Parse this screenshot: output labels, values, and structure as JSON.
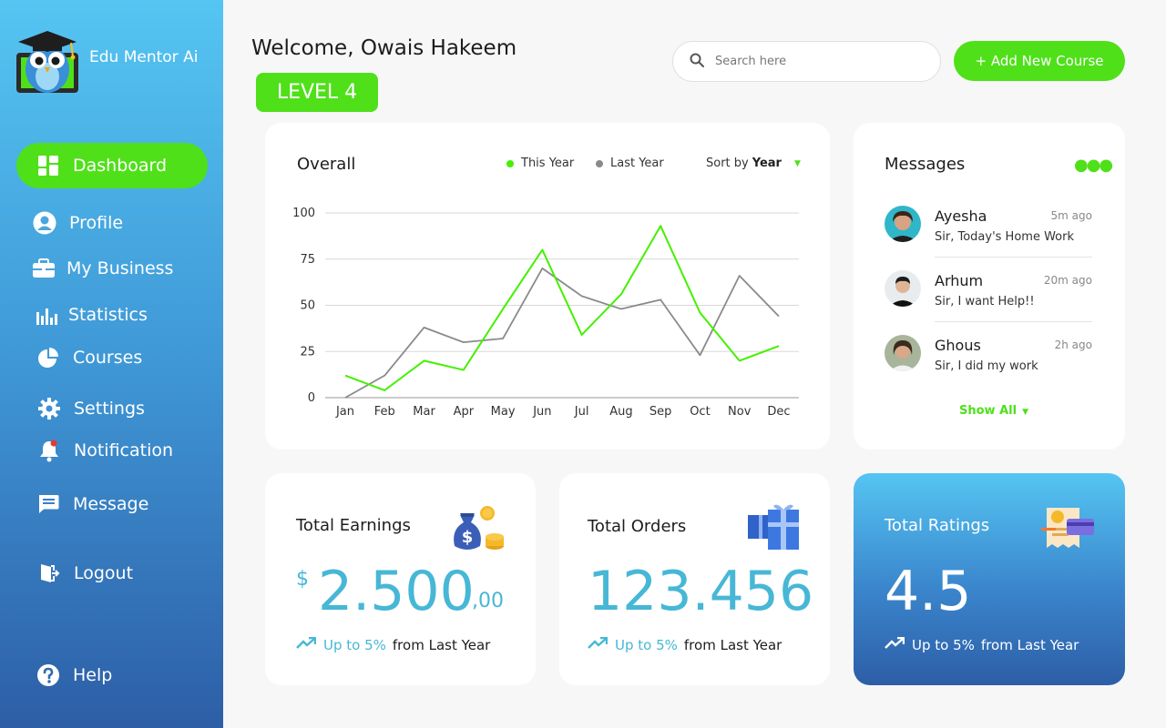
{
  "app": {
    "name": "Edu Mentor Ai",
    "logo_icon": "owl-mascot-icon"
  },
  "sidebar": {
    "items": [
      {
        "label": "Dashboard",
        "icon": "dashboard-icon",
        "active": true
      },
      {
        "label": "Profile",
        "icon": "user-icon"
      },
      {
        "label": "My Business",
        "icon": "briefcase-icon"
      },
      {
        "label": "Statistics",
        "icon": "bar-chart-icon"
      },
      {
        "label": "Courses",
        "icon": "pie-chart-icon"
      },
      {
        "label": "Settings",
        "icon": "gear-icon"
      },
      {
        "label": "Notification",
        "icon": "bell-icon"
      },
      {
        "label": "Message",
        "icon": "message-icon"
      },
      {
        "label": "Logout",
        "icon": "logout-icon"
      },
      {
        "label": "Help",
        "icon": "help-icon"
      }
    ]
  },
  "header": {
    "welcome": "Welcome, Owais Hakeem",
    "level": "LEVEL 4",
    "search_placeholder": "Search here",
    "add_button": "+ Add New Course"
  },
  "overall": {
    "title": "Overall",
    "legend_this_year": "This Year",
    "legend_last_year": "Last Year",
    "sort_label": "Sort by",
    "sort_value": "Year"
  },
  "chart_data": {
    "type": "line",
    "title": "Overall",
    "categories": [
      "Jan",
      "Feb",
      "Mar",
      "Apr",
      "May",
      "Jun",
      "Jul",
      "Aug",
      "Sep",
      "Oct",
      "Nov",
      "Dec"
    ],
    "series": [
      {
        "name": "This Year",
        "color": "#44f000",
        "values": [
          12,
          4,
          20,
          15,
          48,
          80,
          34,
          56,
          93,
          46,
          20,
          28
        ]
      },
      {
        "name": "Last Year",
        "color": "#8a8a8a",
        "values": [
          0,
          12,
          38,
          30,
          32,
          70,
          55,
          48,
          53,
          23,
          66,
          44
        ]
      }
    ],
    "yticks": [
      0,
      25,
      50,
      75,
      100
    ],
    "ylim": [
      0,
      100
    ],
    "grid": true,
    "legend": "top-right"
  },
  "messages": {
    "title": "Messages",
    "show_all": "Show All",
    "items": [
      {
        "name": "Ayesha",
        "time": "5m ago",
        "text": "Sir, Today's Home Work"
      },
      {
        "name": "Arhum",
        "time": "20m ago",
        "text": "Sir, I want Help!!"
      },
      {
        "name": "Ghous",
        "time": "2h ago",
        "text": "Sir, I did my work"
      }
    ]
  },
  "stats": {
    "earnings": {
      "title": "Total Earnings",
      "currency": "$",
      "amount": "2.500",
      "cents": ",00",
      "trend_up": "Up to 5%",
      "trend_rest": "from Last Year",
      "icon": "money-bag-icon"
    },
    "orders": {
      "title": "Total Orders",
      "value": "123.456",
      "trend_up": "Up to 5%",
      "trend_rest": "from Last Year",
      "icon": "gift-box-icon"
    },
    "ratings": {
      "title": "Total Ratings",
      "value": "4.5",
      "trend_up": "Up to 5%",
      "trend_rest": "from Last Year",
      "icon": "receipt-card-icon"
    }
  },
  "colors": {
    "accent_green": "#4fe01a",
    "accent_blue": "#47b7d6",
    "sidebar_top": "#55c5f2",
    "sidebar_bottom": "#2d5ea6"
  }
}
